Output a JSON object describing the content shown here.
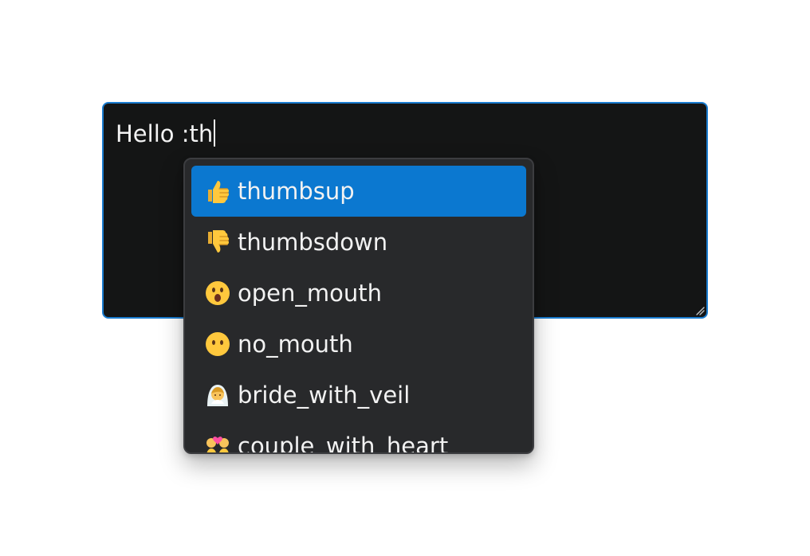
{
  "editor": {
    "text": "Hello :th"
  },
  "autocomplete": {
    "selected_index": 0,
    "items": [
      {
        "icon": "thumbs-up-icon",
        "label": "thumbsup"
      },
      {
        "icon": "thumbs-down-icon",
        "label": "thumbsdown"
      },
      {
        "icon": "open-mouth-face-icon",
        "label": "open_mouth"
      },
      {
        "icon": "no-mouth-face-icon",
        "label": "no_mouth"
      },
      {
        "icon": "bride-with-veil-icon",
        "label": "bride_with_veil"
      },
      {
        "icon": "couple-with-heart-icon",
        "label": "couple_with_heart"
      }
    ]
  },
  "colors": {
    "editor_background": "#141515",
    "editor_border": "#1a7ccf",
    "popup_background": "#28292b",
    "selected_background": "#0b78d0",
    "text": "#f2f2f2"
  }
}
